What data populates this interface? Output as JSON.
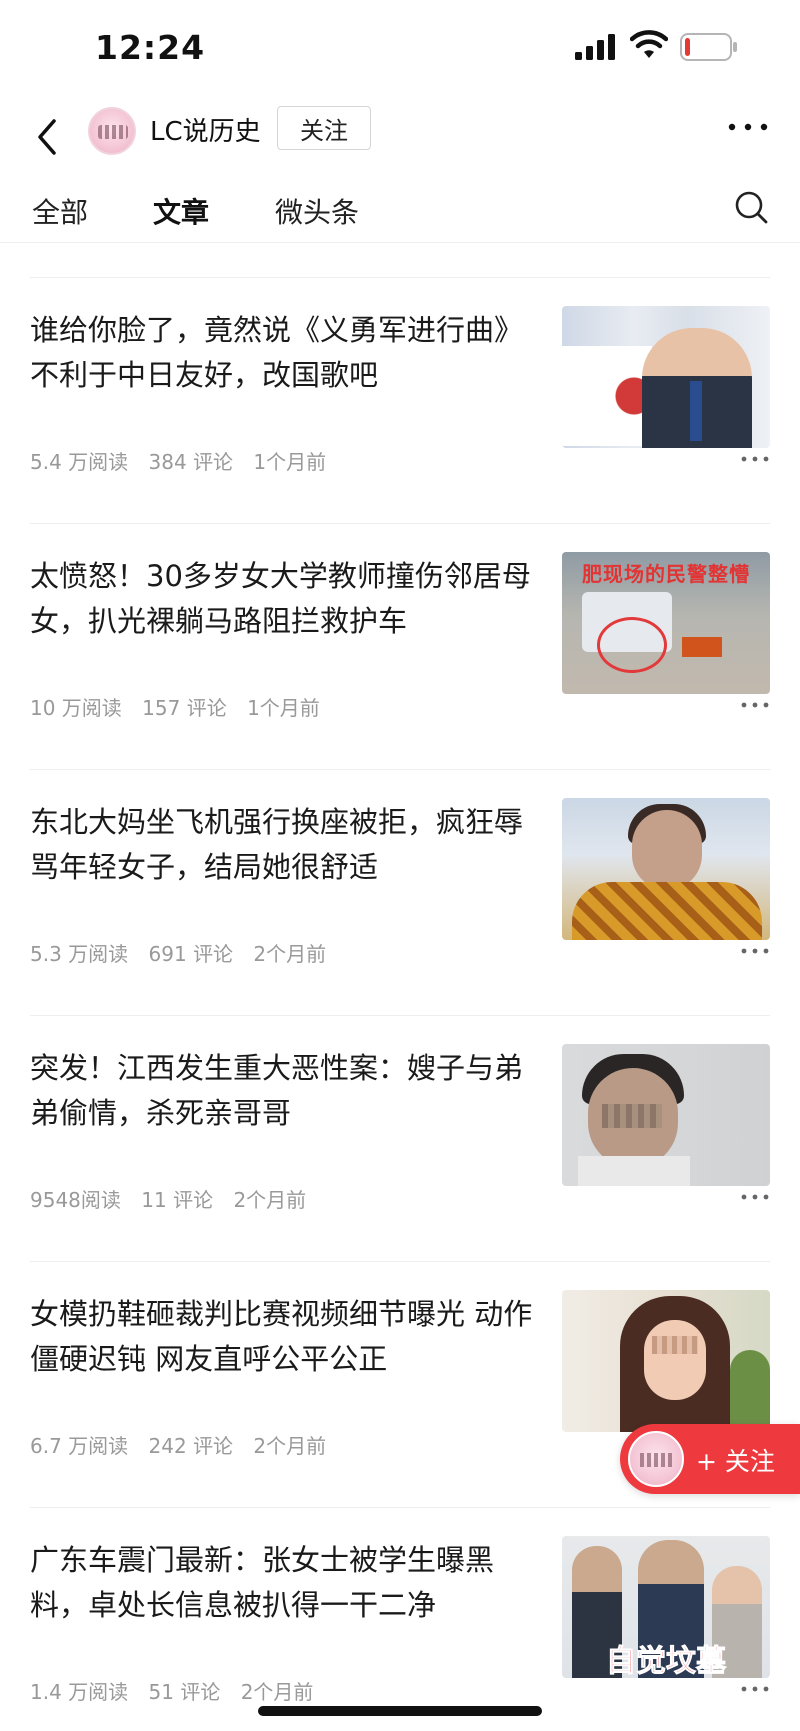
{
  "status_bar": {
    "time": "12:24",
    "signal_icon": "cellular-signal-icon",
    "wifi_icon": "wifi-icon",
    "battery_icon": "battery-low-icon",
    "battery_level": 0.05,
    "battery_color": "#e53935"
  },
  "header": {
    "channel_name": "LC说历史",
    "follow_label": "关注"
  },
  "tabs": [
    {
      "label": "全部",
      "active": false
    },
    {
      "label": "文章",
      "active": true
    },
    {
      "label": "微头条",
      "active": false
    }
  ],
  "articles": [
    {
      "title": "谁给你脸了，竟然说《义勇军进行曲》不利于中日友好，改国歌吧",
      "views": "5.4 万阅读",
      "comments": "384 评论",
      "time": "1个月前",
      "thumb_caption": ""
    },
    {
      "title": "太愤怒！30多岁女大学教师撞伤邻居母女，扒光裸躺马路阻拦救护车",
      "views": "10 万阅读",
      "comments": "157 评论",
      "time": "1个月前",
      "thumb_caption": "肥现场的民警整懵"
    },
    {
      "title": "东北大妈坐飞机强行换座被拒，疯狂辱骂年轻女子，结局她很舒适",
      "views": "5.3 万阅读",
      "comments": "691 评论",
      "time": "2个月前",
      "thumb_caption": ""
    },
    {
      "title": "突发！江西发生重大恶性案：嫂子与弟弟偷情，杀死亲哥哥",
      "views": "9548阅读",
      "comments": "11 评论",
      "time": "2个月前",
      "thumb_caption": ""
    },
    {
      "title": "女模扔鞋砸裁判比赛视频细节曝光 动作僵硬迟钝 网友直呼公平公正",
      "views": "6.7 万阅读",
      "comments": "242 评论",
      "time": "2个月前",
      "thumb_caption": ""
    },
    {
      "title": "广东车震门最新：张女士被学生曝黑料，卓处长信息被扒得一干二净",
      "views": "1.4 万阅读",
      "comments": "51 评论",
      "time": "2个月前",
      "thumb_caption": "自觉坟墓"
    }
  ],
  "floating_follow": {
    "label": "+ 关注"
  },
  "colors": {
    "accent": "#ee3a3f",
    "meta_text": "#999999",
    "divider": "#eeeeee"
  }
}
